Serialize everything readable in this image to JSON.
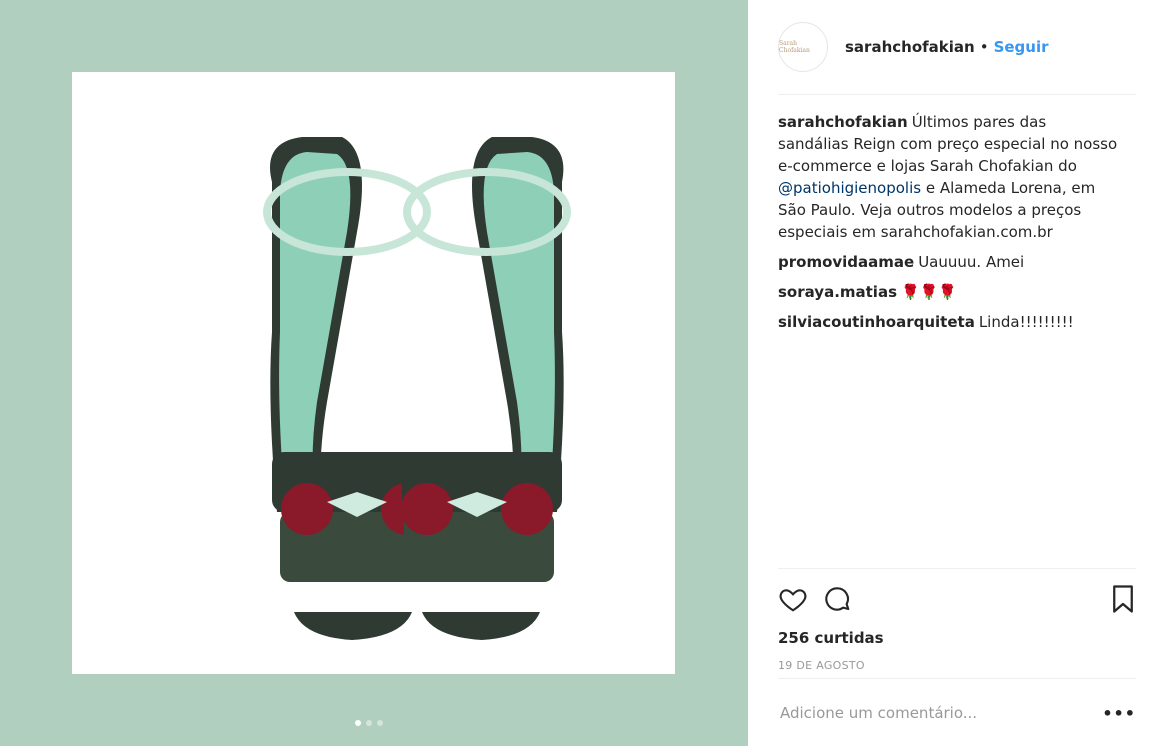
{
  "post": {
    "author": "sarahchofakian",
    "follow_label": "Seguir",
    "avatar_text": "Sarah Chofakian",
    "separator": "•"
  },
  "comments": [
    {
      "user": "sarahchofakian",
      "text_before": "Últimos pares das sandálias Reign com preço especial no nosso e-commerce e lojas Sarah Chofakian do ",
      "mention": "@patiohigienopolis",
      "text_after": " e Alameda Lorena, em São Paulo. Veja outros modelos a preços especiais em sarahchofakian.com.br"
    },
    {
      "user": "promovidaamae",
      "text": "Uauuuu. Amei"
    },
    {
      "user": "soraya.matias",
      "text": "🌹🌹🌹"
    },
    {
      "user": "silviacoutinhoarquiteta",
      "text": "Linda!!!!!!!!!"
    }
  ],
  "stats": {
    "likes": "256 curtidas",
    "date": "19 DE AGOSTO"
  },
  "comment_box": {
    "placeholder": "Adicione um comentário...",
    "more_label": "•••"
  },
  "icons": [
    "heart-icon",
    "comment-icon",
    "bookmark-icon"
  ],
  "colors": {
    "background": "#b1cfbf",
    "link": "#3897f0"
  },
  "carousel": {
    "count": 3,
    "active": 1
  }
}
